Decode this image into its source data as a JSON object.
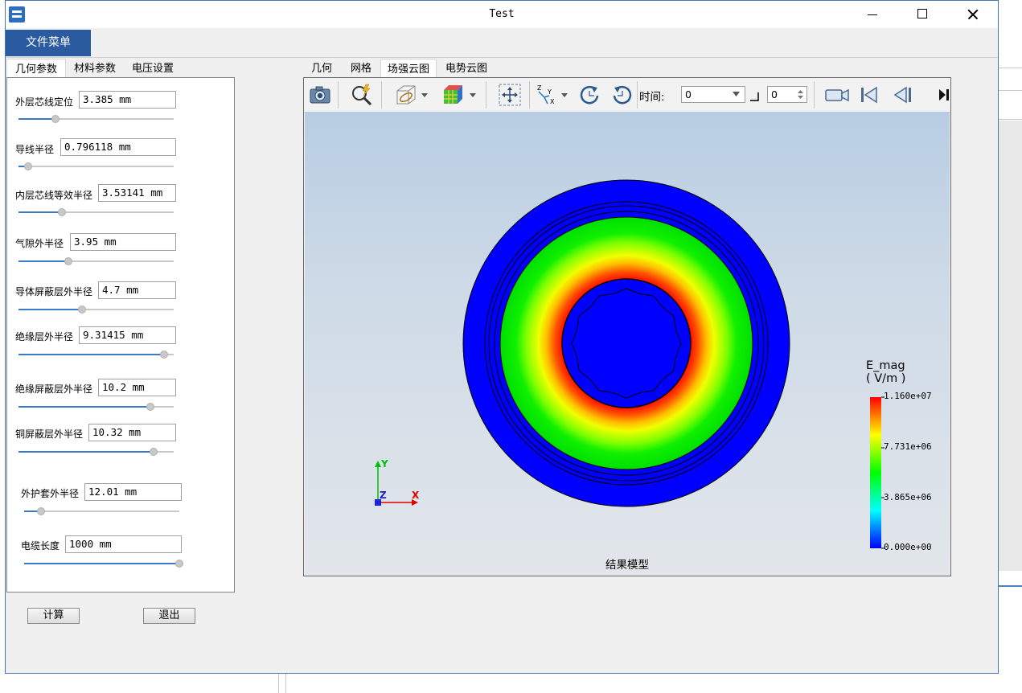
{
  "window": {
    "title": "Test"
  },
  "menu": {
    "file_label": "文件菜单"
  },
  "left_tabs": [
    "几何参数",
    "材料参数",
    "电压设置"
  ],
  "left_tab_active": "几何参数",
  "geometry_fields": [
    {
      "label": "外层芯线定位",
      "value": "3.385 mm",
      "slider": 0.24
    },
    {
      "label": "导线半径",
      "value": "0.796118 mm",
      "slider": 0.06
    },
    {
      "label": "内层芯线等效半径",
      "value": "3.53141 mm",
      "slider": 0.28
    },
    {
      "label": "气隙外半径",
      "value": "3.95 mm",
      "slider": 0.32
    },
    {
      "label": "导体屏蔽层外半径",
      "value": "4.7 mm",
      "slider": 0.41
    },
    {
      "label": "绝缘层外半径",
      "value": "9.31415 mm",
      "slider": 0.94
    },
    {
      "label": "绝缘屏蔽层外半径",
      "value": "10.2 mm",
      "slider": 0.85
    },
    {
      "label": "铜屏蔽层外半径",
      "value": "10.32 mm",
      "slider": 0.87
    },
    {
      "label": "外护套外半径",
      "value": "12.01 mm",
      "slider": 0.11
    },
    {
      "label": "电缆长度",
      "value": "1000 mm",
      "slider": 1.0
    }
  ],
  "buttons": {
    "calculate": "计算",
    "exit": "退出"
  },
  "view_tabs": [
    "几何",
    "网格",
    "场强云图",
    "电势云图"
  ],
  "view_tab_active": "场强云图",
  "toolbar": {
    "time_label": "时间:",
    "time_value": "0",
    "step_value": "0"
  },
  "scene": {
    "caption": "结果模型",
    "axes": {
      "x": "X",
      "y": "Y",
      "z": "Z"
    }
  },
  "legend": {
    "title_line1": "E_mag",
    "title_line2": "( V/m )",
    "ticks": [
      "1.160e+07",
      "7.731e+06",
      "3.865e+06",
      "0.000e+00"
    ]
  },
  "colors": {
    "menu_accent": "#2a5aa0",
    "slider_fill": "#3a7ac8",
    "field_high": "#ff0000",
    "field_mid": "#00e000",
    "field_low": "#0000ff"
  }
}
